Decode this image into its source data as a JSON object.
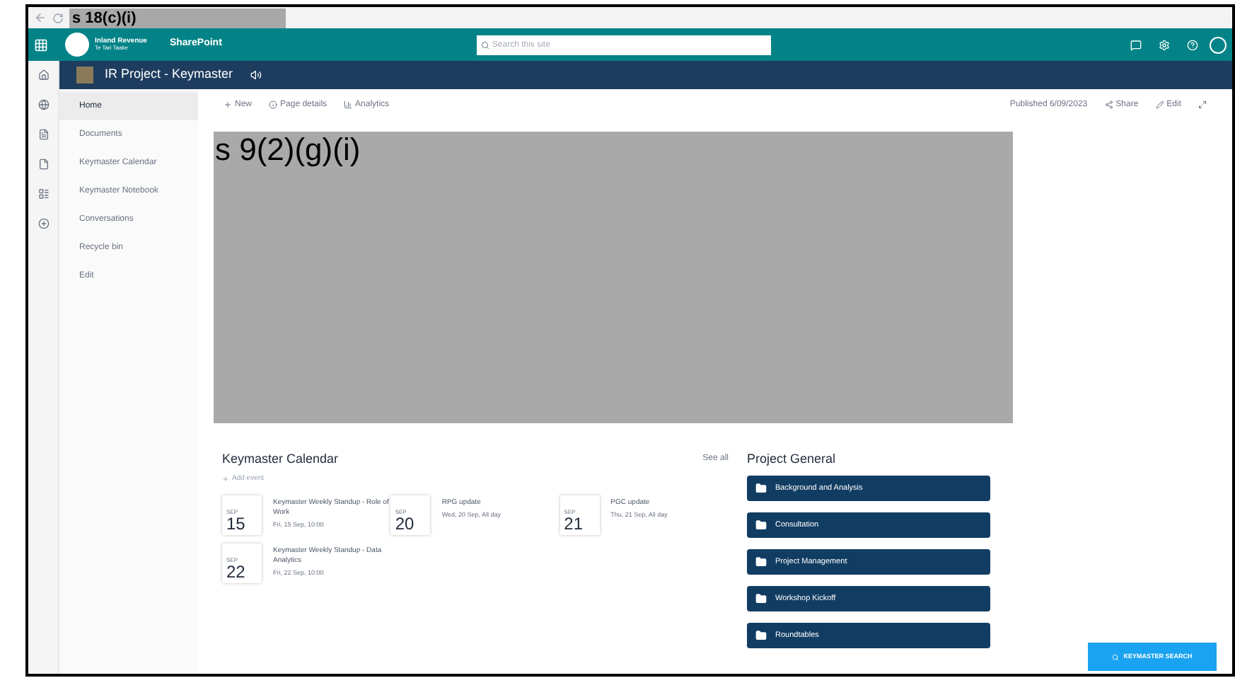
{
  "browser_bar": {
    "redaction": "s 18(c)(i)"
  },
  "suite_bar": {
    "org_name": "Inland Revenue",
    "org_subtitle": "Te Tari Taake",
    "app_name": "SharePoint",
    "search": {
      "placeholder": "Search this site"
    }
  },
  "site_header": {
    "title": "IR Project - Keymaster"
  },
  "nav": [
    {
      "label": "Home",
      "selected": true
    },
    {
      "label": "Documents",
      "selected": false
    },
    {
      "label": "Keymaster Calendar",
      "selected": false
    },
    {
      "label": "Keymaster Notebook",
      "selected": false
    },
    {
      "label": "Conversations",
      "selected": false
    },
    {
      "label": "Recycle bin",
      "selected": false
    },
    {
      "label": "Edit",
      "selected": false
    }
  ],
  "command_bar": {
    "new": "New",
    "page_details": "Page details",
    "analytics": "Analytics",
    "published": "Published 6/09/2023",
    "share": "Share",
    "edit": "Edit"
  },
  "hero": {
    "redaction": "s 9(2)(g)(i)"
  },
  "calendar": {
    "title": "Keymaster Calendar",
    "see_all": "See all",
    "add_event": "Add event",
    "events": [
      {
        "month": "SEP",
        "day": "15",
        "title": "Keymaster Weekly Standup - Role of Work",
        "time": "Fri, 15 Sep, 10:00"
      },
      {
        "month": "SEP",
        "day": "20",
        "title": "RPG update",
        "time": "Wed, 20 Sep, All day"
      },
      {
        "month": "SEP",
        "day": "21",
        "title": "PGC update",
        "time": "Thu, 21 Sep, All day"
      },
      {
        "month": "SEP",
        "day": "22",
        "title": "Keymaster Weekly Standup - Data Analytics",
        "time": "Fri, 22 Sep, 10:00"
      }
    ]
  },
  "project_general": {
    "title": "Project General",
    "links": [
      "Background and Analysis",
      "Consultation",
      "Project Management",
      "Workshop Kickoff",
      "Roundtables"
    ]
  },
  "search_button": "KEYMASTER SEARCH"
}
